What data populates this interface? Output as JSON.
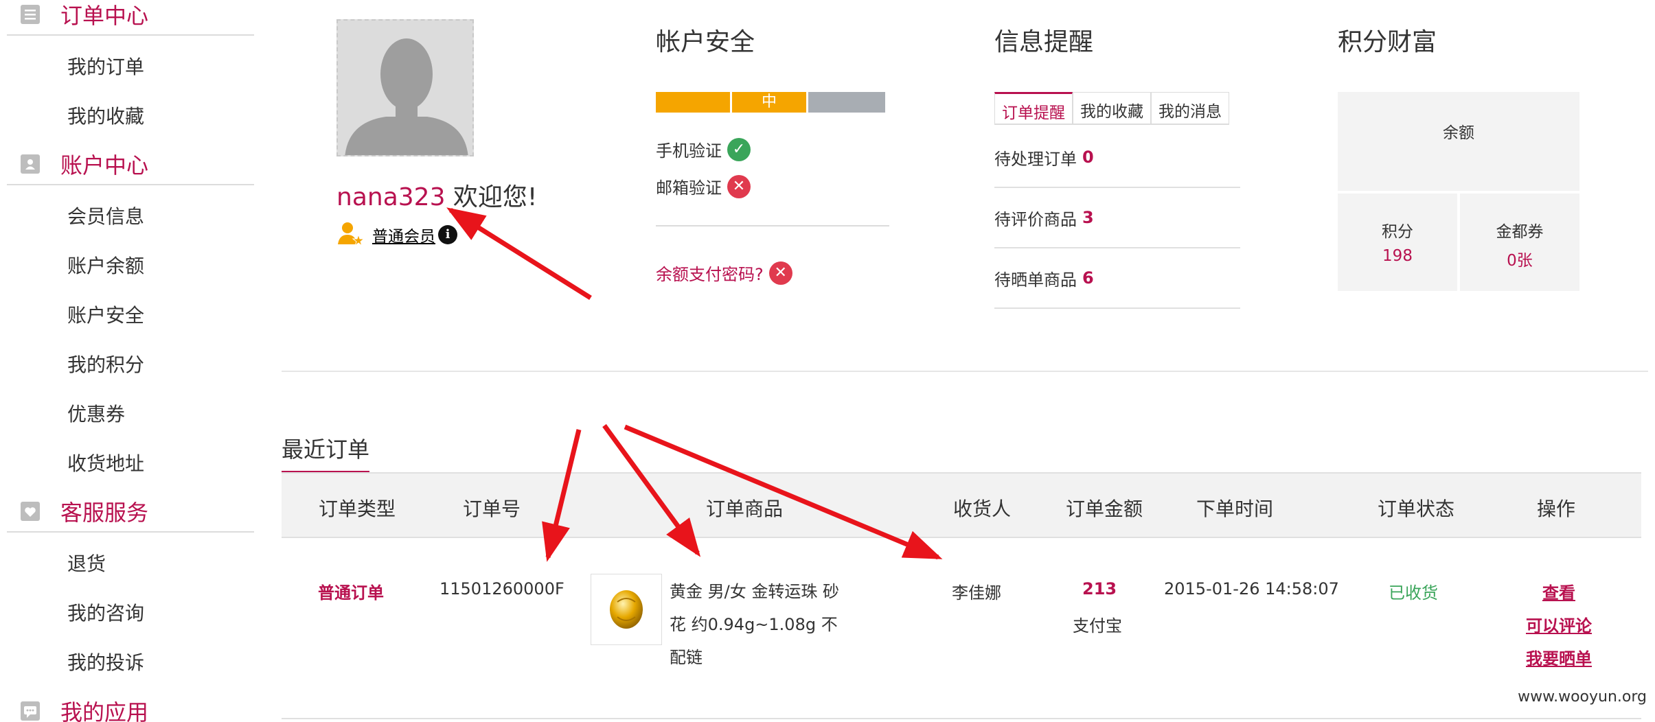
{
  "sidebar": {
    "order_center": {
      "title": "订单中心",
      "items": [
        "我的订单",
        "我的收藏"
      ]
    },
    "account_center": {
      "title": "账户中心",
      "items": [
        "会员信息",
        "账户余额",
        "账户安全",
        "我的积分",
        "优惠券",
        "收货地址"
      ]
    },
    "service": {
      "title": "客服服务",
      "items": [
        "退货",
        "我的咨询",
        "我的投诉"
      ]
    },
    "apps": {
      "title": "我的应用"
    }
  },
  "profile": {
    "username": "nana323",
    "welcome": "欢迎您!",
    "member_level": "普通会员",
    "info_icon": "i"
  },
  "security": {
    "title": "帐户安全",
    "level": "中",
    "level_segments": 3,
    "level_filled": 2,
    "phone_label": "手机验证",
    "phone_verified": true,
    "email_label": "邮箱验证",
    "email_verified": false,
    "pay_password_label": "余额支付密码?",
    "pay_password_set": false,
    "colors": {
      "filled": "#f5a500",
      "empty": "#a8adb3",
      "ok": "#3aa55a",
      "no": "#e03a4e"
    }
  },
  "reminders": {
    "title": "信息提醒",
    "tabs": [
      "订单提醒",
      "我的收藏",
      "我的消息"
    ],
    "active_tab": 0,
    "rows": [
      {
        "label": "待处理订单",
        "count": "0"
      },
      {
        "label": "待评价商品",
        "count": "3"
      },
      {
        "label": "待晒单商品",
        "count": "6"
      }
    ]
  },
  "wealth": {
    "title": "积分财富",
    "balance_label": "余额",
    "points_label": "积分",
    "points_value": "198",
    "voucher_label": "金都券",
    "voucher_value": "0张"
  },
  "recent_orders": {
    "title": "最近订单",
    "columns": [
      "订单类型",
      "订单号",
      "订单商品",
      "收货人",
      "订单金额",
      "下单时间",
      "订单状态",
      "操作"
    ],
    "rows": [
      {
        "type": "普通订单",
        "order_no": "11501260000F",
        "product": "黄金 男/女 金转运珠 砂花 约0.94g~1.08g 不配链",
        "receiver": "李佳娜",
        "amount": "213",
        "payment": "支付宝",
        "time": "2015-01-26 14:58:07",
        "status": "已收货",
        "actions": [
          "查看",
          "可以评论",
          "我要晒单"
        ]
      }
    ]
  },
  "watermark": "www.wooyun.org",
  "accent_color": "#b8114f"
}
